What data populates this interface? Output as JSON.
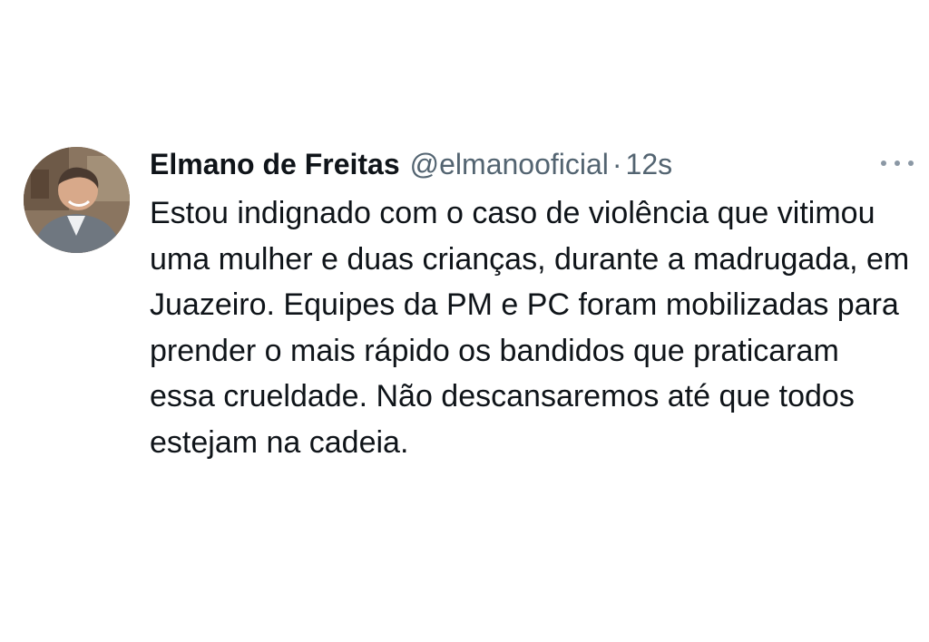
{
  "tweet": {
    "author": {
      "display_name": "Elmano de Freitas",
      "handle": "@elmanooficial"
    },
    "separator": "·",
    "timestamp": "12s",
    "text": "Estou indignado com o caso de violência que vitimou uma mulher e duas crianças, durante a madrugada, em Juazeiro. Equipes da PM e PC foram mobilizadas para prender o mais rápido os bandidos que praticaram essa crueldade. Não descansaremos até que todos estejam na cadeia.",
    "more_icon": "more-horizontal-icon"
  },
  "colors": {
    "text_primary": "#0f1419",
    "text_secondary": "#536471",
    "background": "#ffffff"
  }
}
